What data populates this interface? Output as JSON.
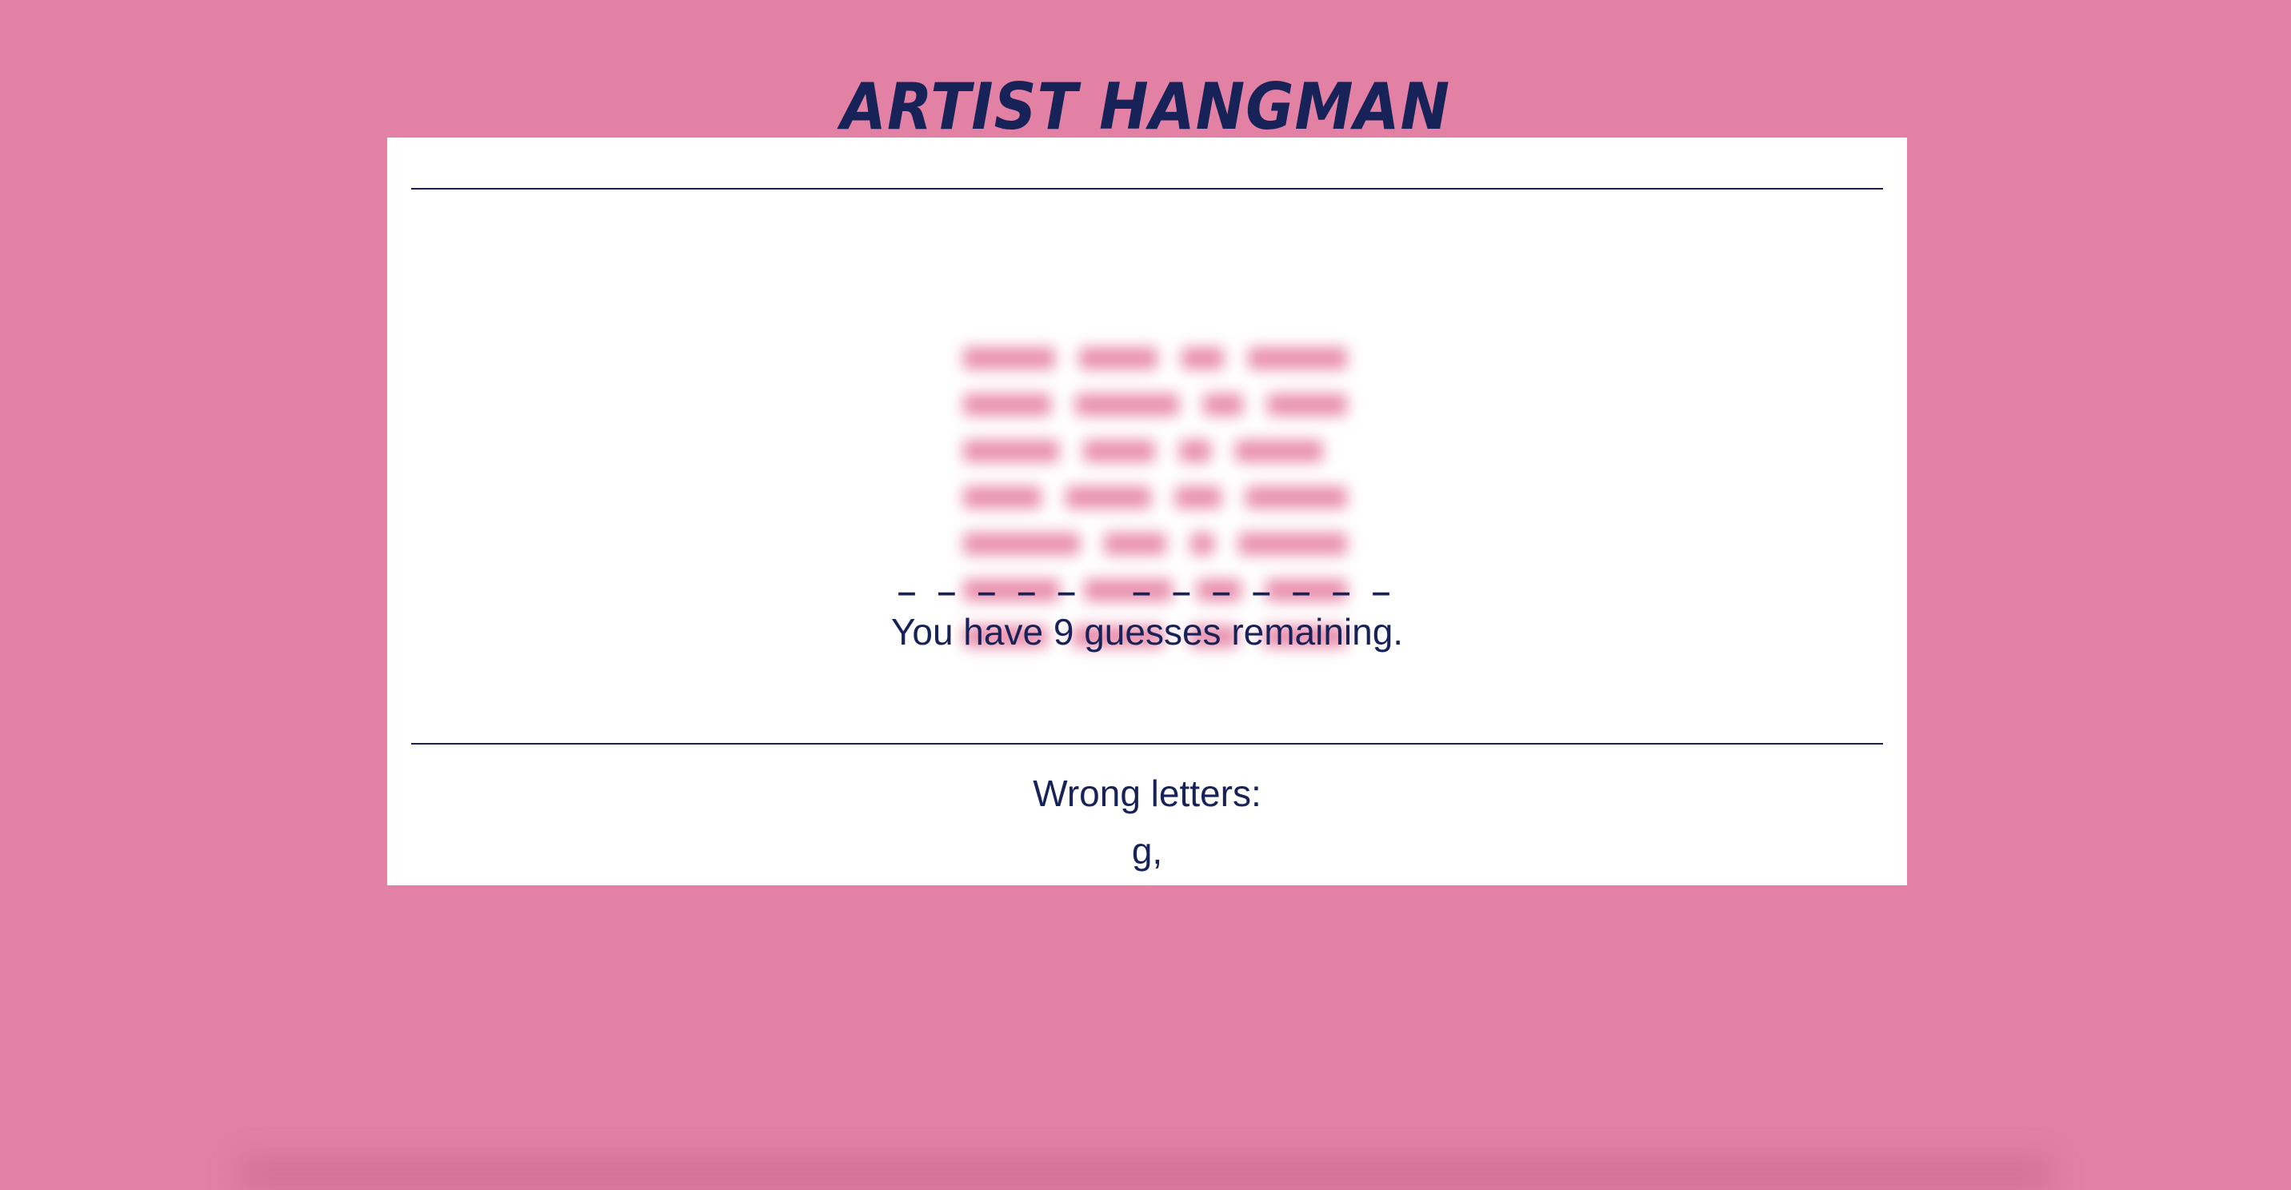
{
  "app": {
    "title": "ARTIST HANGMAN"
  },
  "game": {
    "masked_word": "_ _ _ _ _   _ _ _ _ _ _ _",
    "guesses_text": "You have 9 guesses remaining.",
    "guesses_remaining": 9,
    "wrong_letters_label": "Wrong letters:",
    "wrong_letters": "g,"
  },
  "artwork": {
    "state": "blurred",
    "color": "#e26a92"
  },
  "theme": {
    "background": "#e381a4",
    "card": "#ffffff",
    "text": "#172258"
  }
}
